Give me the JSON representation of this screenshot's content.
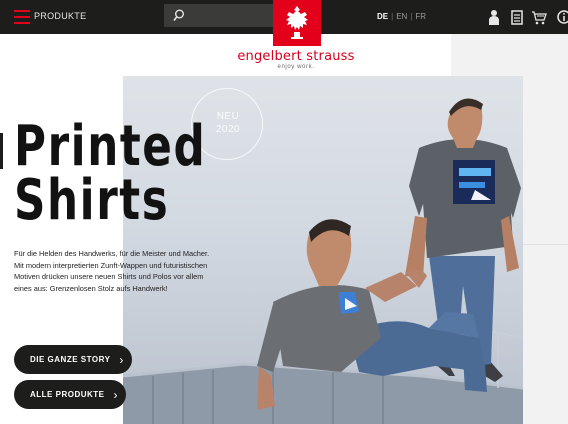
{
  "header": {
    "menu_label": "PRODUKTE",
    "search": {
      "value": "",
      "placeholder": ""
    },
    "languages": [
      {
        "code": "DE",
        "active": true
      },
      {
        "code": "EN",
        "active": false
      },
      {
        "code": "FR",
        "active": false
      }
    ],
    "icons": [
      "user-icon",
      "list-icon",
      "cart-icon",
      "info-icon"
    ]
  },
  "brand": {
    "name": "engelbert strauss",
    "tagline": "enjoy work."
  },
  "hero": {
    "badge_line1": "NEU",
    "badge_line2": "2020",
    "headline_line1": "Printed",
    "headline_line2": "Shirts",
    "description": "Für die Helden des Handwerks, für die Meister und Macher. Mit modern interpretierten Zunft-Wappen und futuristischen Motiven drücken unsere neuen Shirts und Polos vor allem eines aus: Grenzenlosen Stolz aufs Handwerk!",
    "cta_story": "DIE GANZE STORY",
    "cta_products": "ALLE PRODUKTE"
  },
  "colors": {
    "brand_red": "#e3001b",
    "bar": "#1d1d1b",
    "panel": "#f2f2f2"
  }
}
